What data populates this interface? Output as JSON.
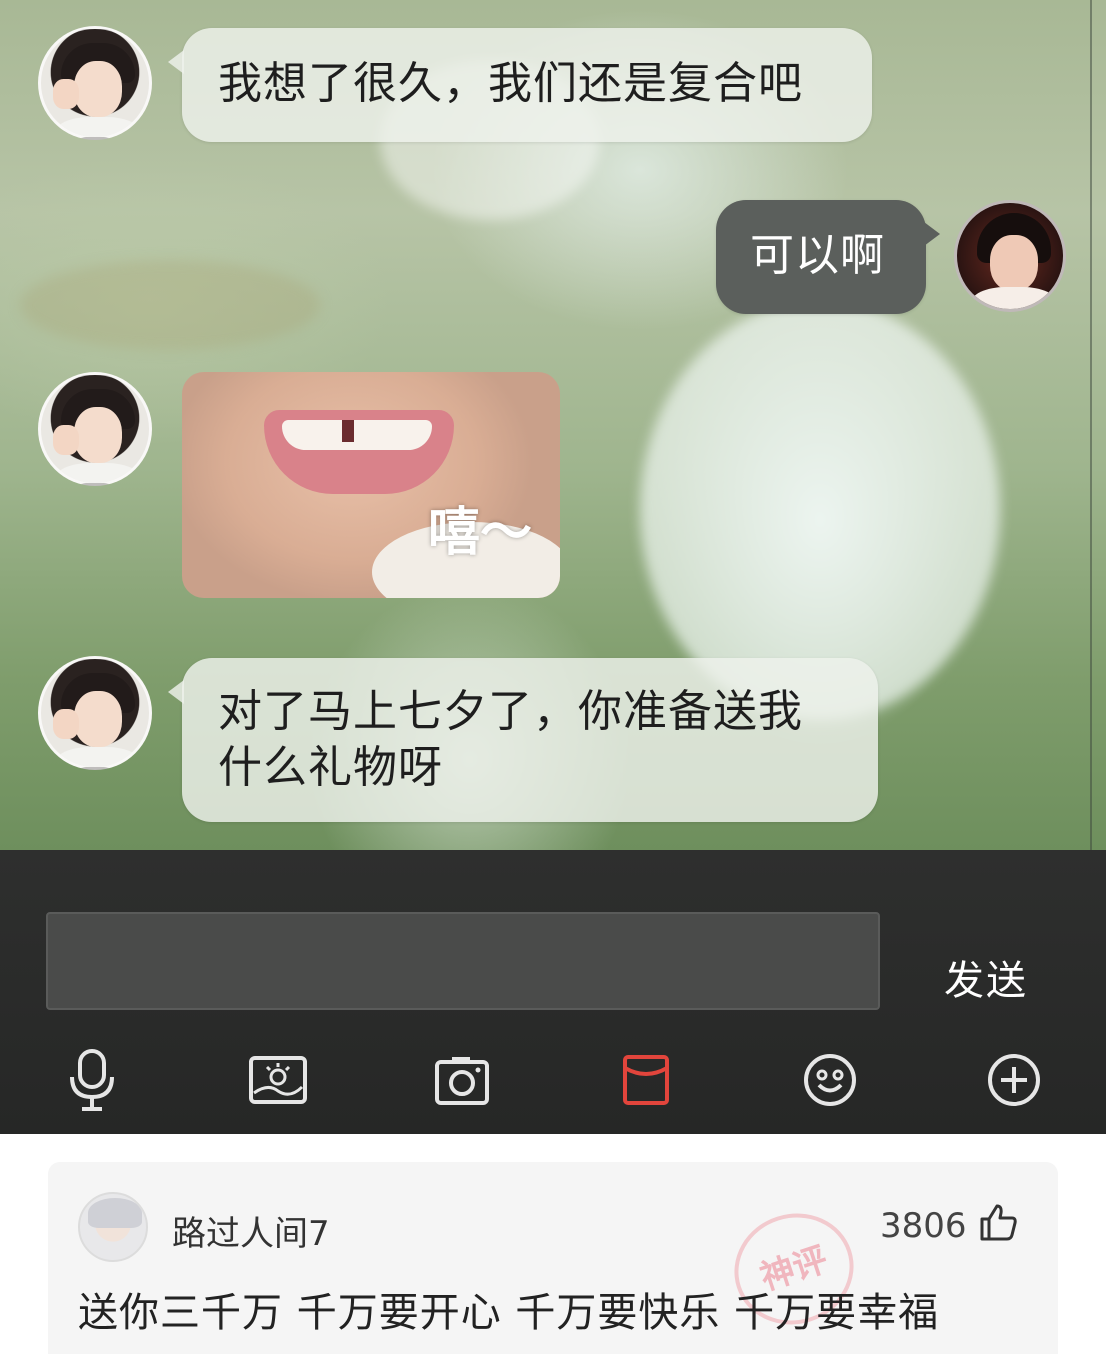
{
  "messages": [
    {
      "side": "left",
      "text": "我想了很久，我们还是复合吧"
    },
    {
      "side": "right",
      "text": "可以啊"
    },
    {
      "side": "left",
      "type": "sticker",
      "caption": "嘻～"
    },
    {
      "side": "left",
      "text_line1": "对了马上七夕了，你准备送我",
      "text_line2": "什么礼物呀"
    }
  ],
  "input": {
    "value": "",
    "placeholder": ""
  },
  "send_label": "发送",
  "toolbar": [
    {
      "icon": "microphone-icon"
    },
    {
      "icon": "image-gallery-icon"
    },
    {
      "icon": "camera-icon"
    },
    {
      "icon": "red-envelope-icon",
      "color": "#e2453c"
    },
    {
      "icon": "emoji-icon"
    },
    {
      "icon": "plus-icon"
    }
  ],
  "comment": {
    "username": "路过人间7",
    "likes": "3806",
    "text": "送你三千万 千万要开心 千万要快乐 千万要幸福",
    "badge": "神评"
  }
}
